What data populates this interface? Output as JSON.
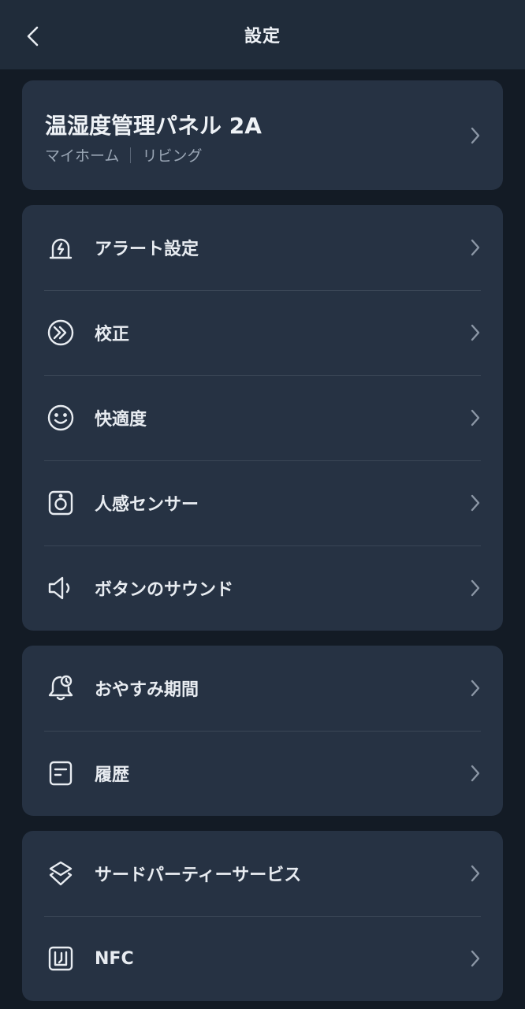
{
  "header": {
    "title": "設定"
  },
  "device": {
    "name": "温湿度管理パネル 2A",
    "home": "マイホーム",
    "room": "リビング"
  },
  "groups": [
    {
      "items": [
        {
          "label": "アラート設定",
          "icon": "alarm-icon"
        },
        {
          "label": "校正",
          "icon": "calibration-icon"
        },
        {
          "label": "快適度",
          "icon": "smile-icon"
        },
        {
          "label": "人感センサー",
          "icon": "motion-sensor-icon"
        },
        {
          "label": "ボタンのサウンド",
          "icon": "speaker-icon"
        }
      ]
    },
    {
      "items": [
        {
          "label": "おやすみ期間",
          "icon": "bell-clock-icon"
        },
        {
          "label": "履歴",
          "icon": "history-icon"
        }
      ]
    },
    {
      "items": [
        {
          "label": "サードパーティーサービス",
          "icon": "layers-icon"
        },
        {
          "label": "NFC",
          "icon": "nfc-icon"
        }
      ]
    }
  ],
  "colors": {
    "background": "#131b25",
    "header": "#202c3a",
    "card": "#263243",
    "divider": "#3a4656",
    "text": "#e8ecf1",
    "subtext": "#9aa6b5",
    "chevron": "#8b96a5"
  }
}
